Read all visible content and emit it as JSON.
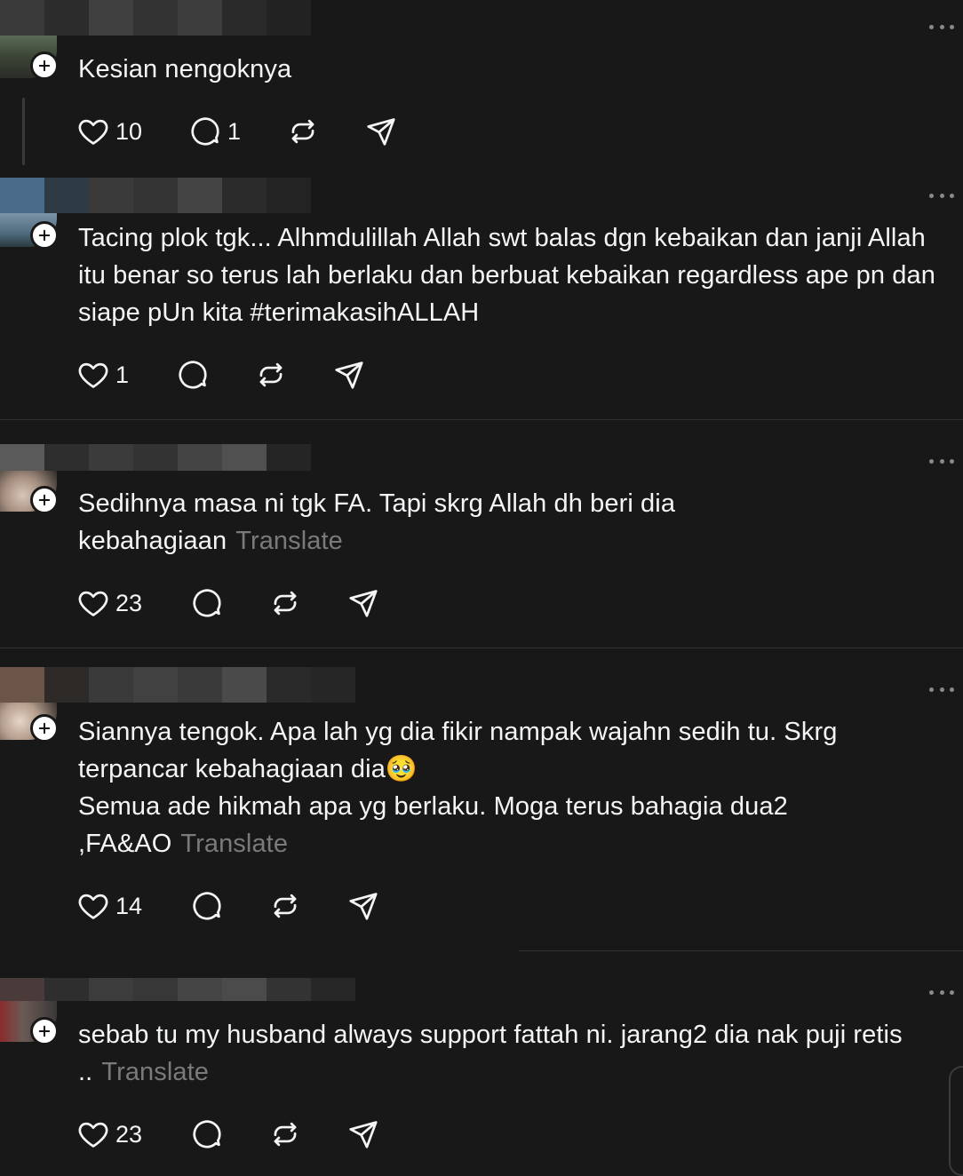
{
  "posts": [
    {
      "text": "Kesian nengoknya",
      "translate": "",
      "likes": "10",
      "replies": "1"
    },
    {
      "text": "Tacing plok tgk... Alhmdulillah Allah swt balas dgn kebaikan dan janji Allah itu benar so terus lah berlaku dan berbuat kebaikan regardless ape pn dan siape pUn kita #terimakasihALLAH",
      "translate": "",
      "likes": "1",
      "replies": ""
    },
    {
      "text": "Sedihnya masa ni tgk FA. Tapi skrg Allah dh beri dia kebahagiaan",
      "translate": "Translate",
      "likes": "23",
      "replies": ""
    },
    {
      "text_line1": "Siannya tengok. Apa lah yg dia fikir nampak wajahn sedih tu. Skrg terpancar kebahagiaan dia🥹",
      "text_line2": "Semua ade hikmah apa yg berlaku. Moga terus bahagia dua2 ,FA&AO",
      "translate": "Translate",
      "likes": "14",
      "replies": ""
    },
    {
      "text": "sebab tu my husband always support fattah ni. jarang2 dia nak puji retis ..",
      "translate": "Translate",
      "likes": "23",
      "replies": ""
    }
  ],
  "icons": {
    "like": "heart-icon",
    "reply": "comment-icon",
    "repost": "repost-icon",
    "share": "send-icon",
    "more": "more-icon",
    "follow": "plus-icon"
  }
}
